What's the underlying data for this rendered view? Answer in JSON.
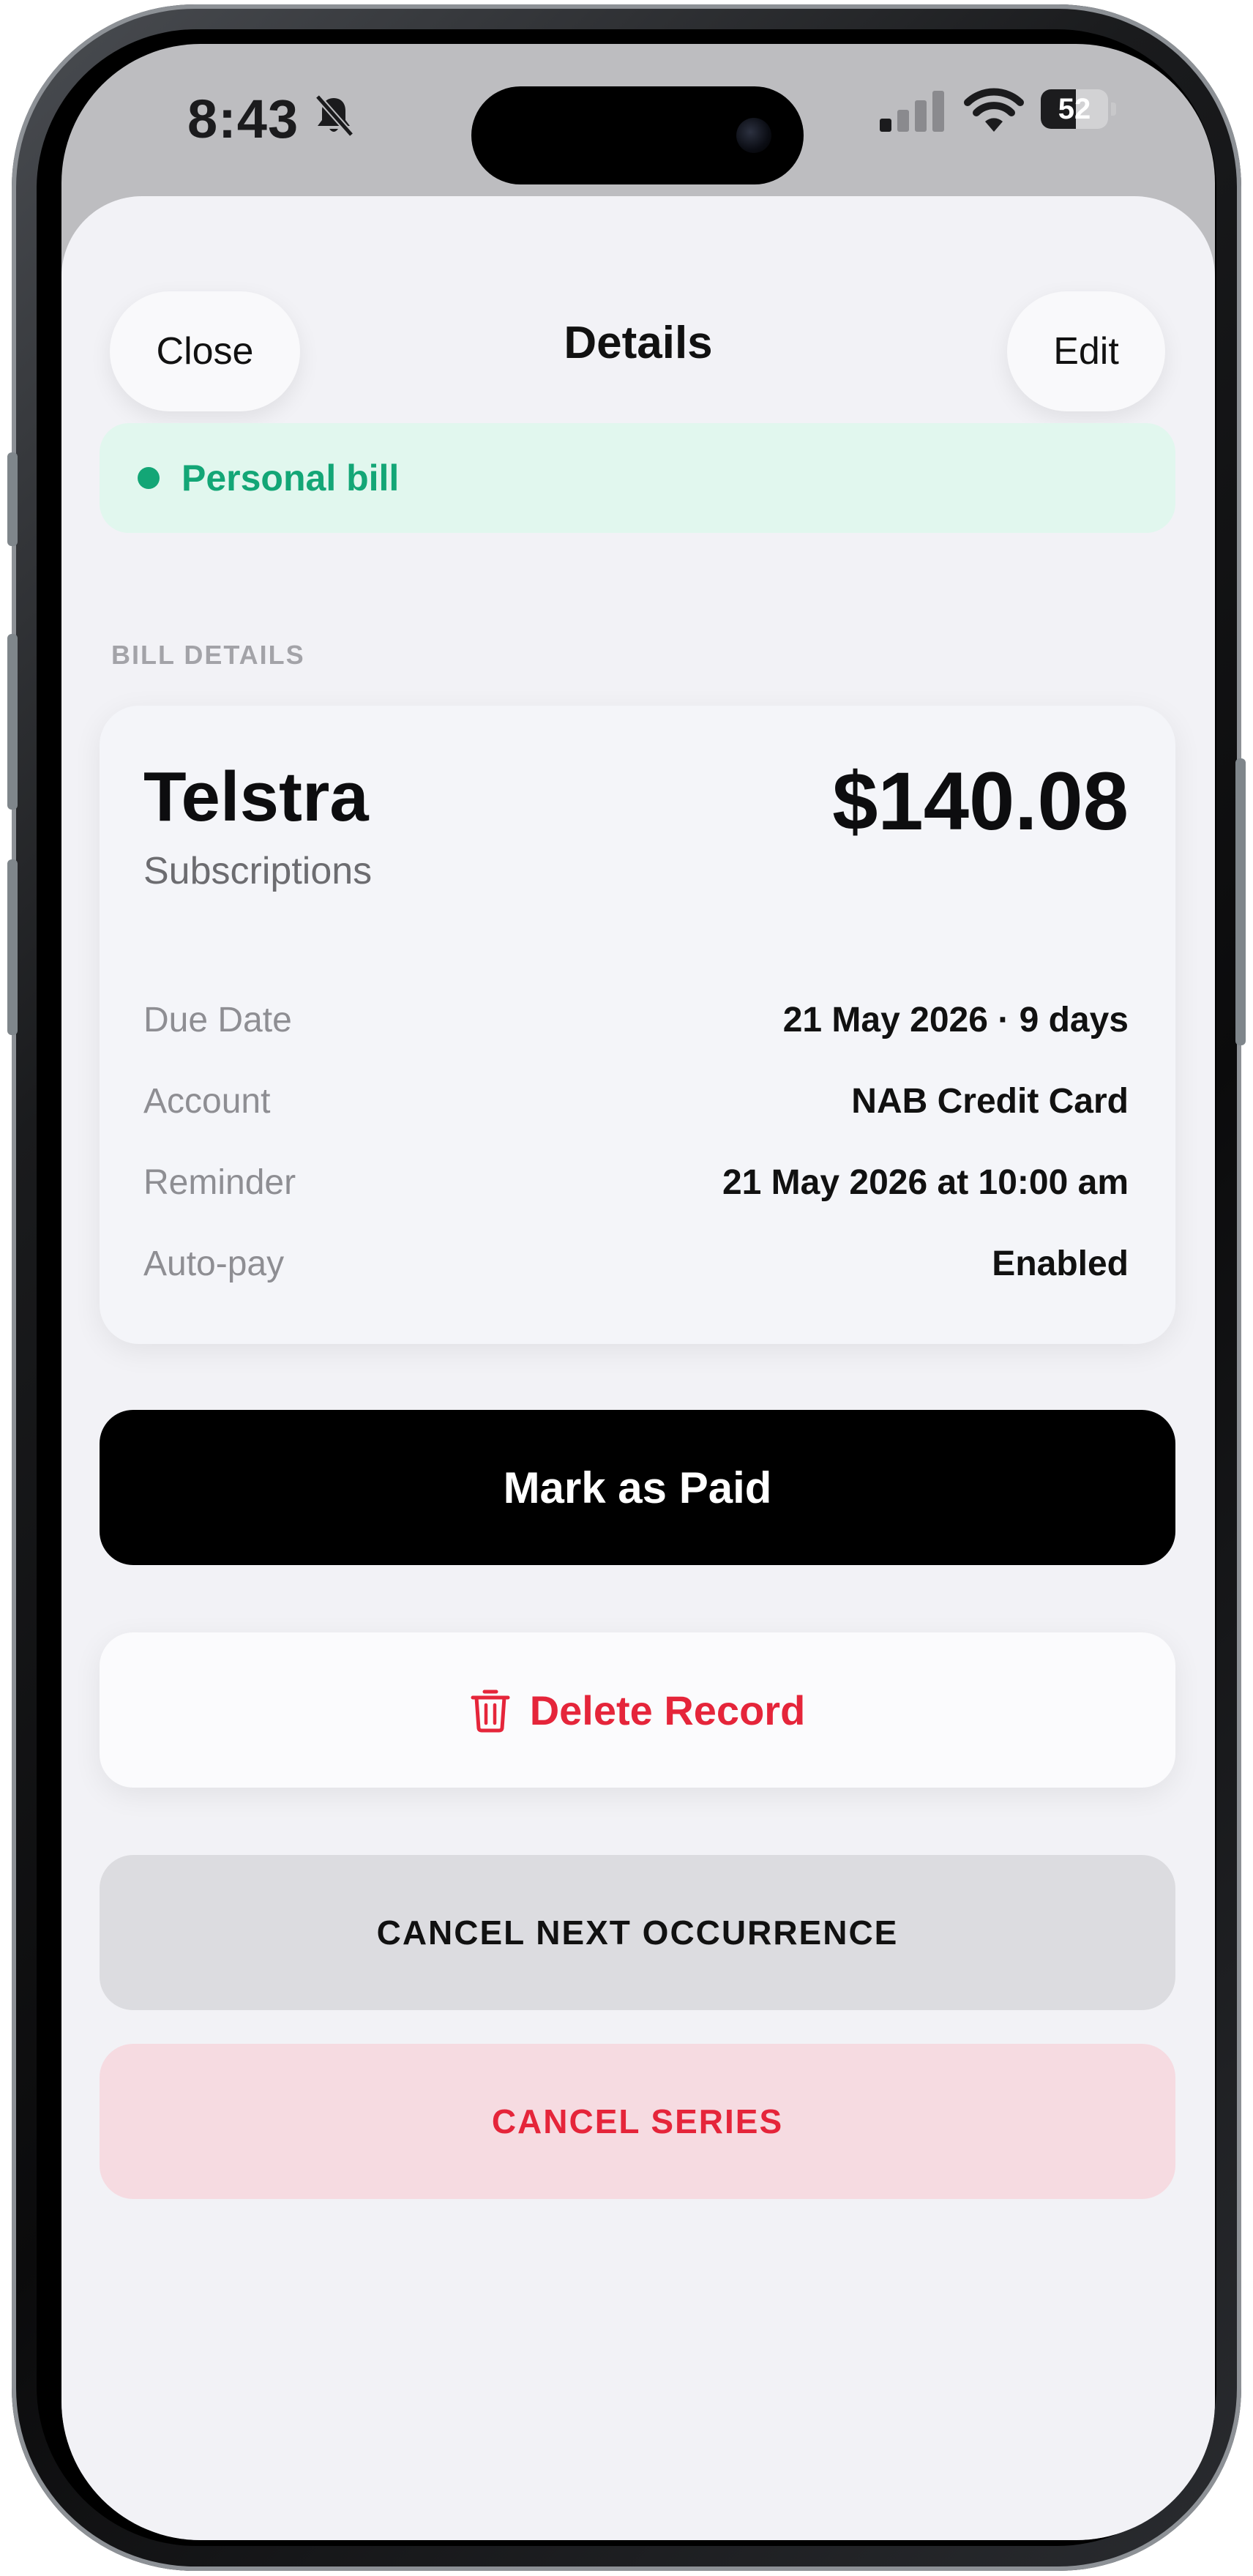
{
  "status_bar": {
    "time": "8:43",
    "battery_level": "52",
    "battery_fraction": 0.52
  },
  "header": {
    "close_label": "Close",
    "title": "Details",
    "edit_label": "Edit"
  },
  "bill_type": {
    "label": "Personal bill",
    "color": "#13a676"
  },
  "section": {
    "header": "BILL DETAILS"
  },
  "bill": {
    "payee": "Telstra",
    "category": "Subscriptions",
    "amount": "$140.08",
    "details": [
      {
        "key": "Due Date",
        "value": "21 May 2026 · 9 days"
      },
      {
        "key": "Account",
        "value": "NAB Credit Card"
      },
      {
        "key": "Reminder",
        "value": "21 May 2026 at 10:00 am"
      },
      {
        "key": "Auto-pay",
        "value": "Enabled"
      }
    ]
  },
  "actions": {
    "mark_paid": "Mark as Paid",
    "delete": "Delete Record",
    "cancel_next": "CANCEL NEXT OCCURRENCE",
    "cancel_series": "CANCEL SERIES"
  },
  "colors": {
    "destructive": "#e5253a",
    "sheet_background": "#f2f2f6",
    "primary_button": "#000000"
  },
  "icons": [
    "bell-slash-icon",
    "signal-icon",
    "wifi-icon",
    "battery-icon",
    "trash-icon"
  ]
}
